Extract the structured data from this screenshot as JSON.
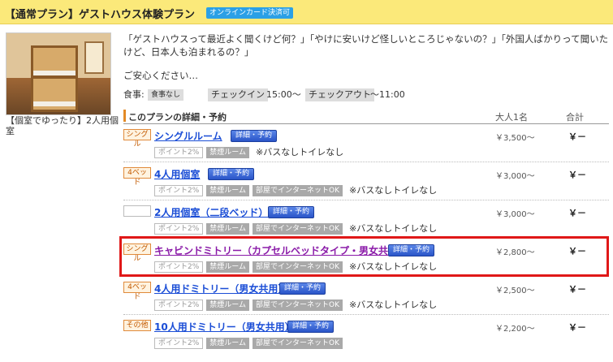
{
  "header": {
    "title": "【通常プラン】ゲストハウス体験プラン",
    "badge": "オンラインカード決済可"
  },
  "photo": {
    "caption": "【個室でゆったり】2人用個室"
  },
  "intro": {
    "text": "「ゲストハウスって最近よく聞くけど何？」「やけに安いけど怪しいところじゃないの？」「外国人ばかりって聞いたけど、日本人も泊まれるの？」",
    "reassure": "ご安心ください…"
  },
  "meta": {
    "meal_label": "食事:",
    "meal_value": "食事なし",
    "checkin_label": "チェックイン",
    "checkin_value": "15:00～",
    "checkout_label": "チェックアウト",
    "checkout_value": "～11:00"
  },
  "section": {
    "title": "このプランの詳細・予約",
    "col_adult": "大人1名",
    "col_total": "合計"
  },
  "rows": [
    {
      "type": "シングル",
      "name": "シングルルーム",
      "btn": "詳細・予約",
      "price": "￥3,500～",
      "total": "￥－",
      "chips": [
        "ポイント2%",
        "禁煙ルーム"
      ],
      "note": "※バスなしトイレなし"
    },
    {
      "type": "4ベッド",
      "name": "4人用個室",
      "btn": "詳細・予約",
      "price": "￥3,000～",
      "total": "￥－",
      "chips": [
        "ポイント2%",
        "禁煙ルーム",
        "部屋でインターネットOK"
      ],
      "note": "※バスなしトイレなし"
    },
    {
      "type": "",
      "name": "2人用個室（二段ベッド）",
      "btn": "詳細・予約",
      "price": "￥3,000～",
      "total": "￥－",
      "chips": [
        "ポイント2%",
        "禁煙ルーム",
        "部屋でインターネットOK"
      ],
      "note": "※バスなしトイレなし"
    },
    {
      "type": "シングル",
      "name": "キャビンドミトリー（カプセルベッドタイプ・男女共用）",
      "btn": "詳細・予約",
      "price": "￥2,800～",
      "total": "￥－",
      "chips": [
        "ポイント2%",
        "禁煙ルーム",
        "部屋でインターネットOK"
      ],
      "note": "※バスなしトイレなし"
    },
    {
      "type": "4ベッド",
      "name": "4人用ドミトリー（男女共用）",
      "btn": "詳細・予約",
      "price": "￥2,500～",
      "total": "￥－",
      "chips": [
        "ポイント2%",
        "禁煙ルーム",
        "部屋でインターネットOK"
      ],
      "note": "※バスなしトイレなし"
    },
    {
      "type": "その他",
      "name": "10人用ドミトリー（男女共用）",
      "btn": "詳細・予約",
      "price": "￥2,200～",
      "total": "￥－",
      "chips": [
        "ポイント2%",
        "禁煙ルーム",
        "部屋でインターネットOK"
      ],
      "note": ""
    }
  ]
}
